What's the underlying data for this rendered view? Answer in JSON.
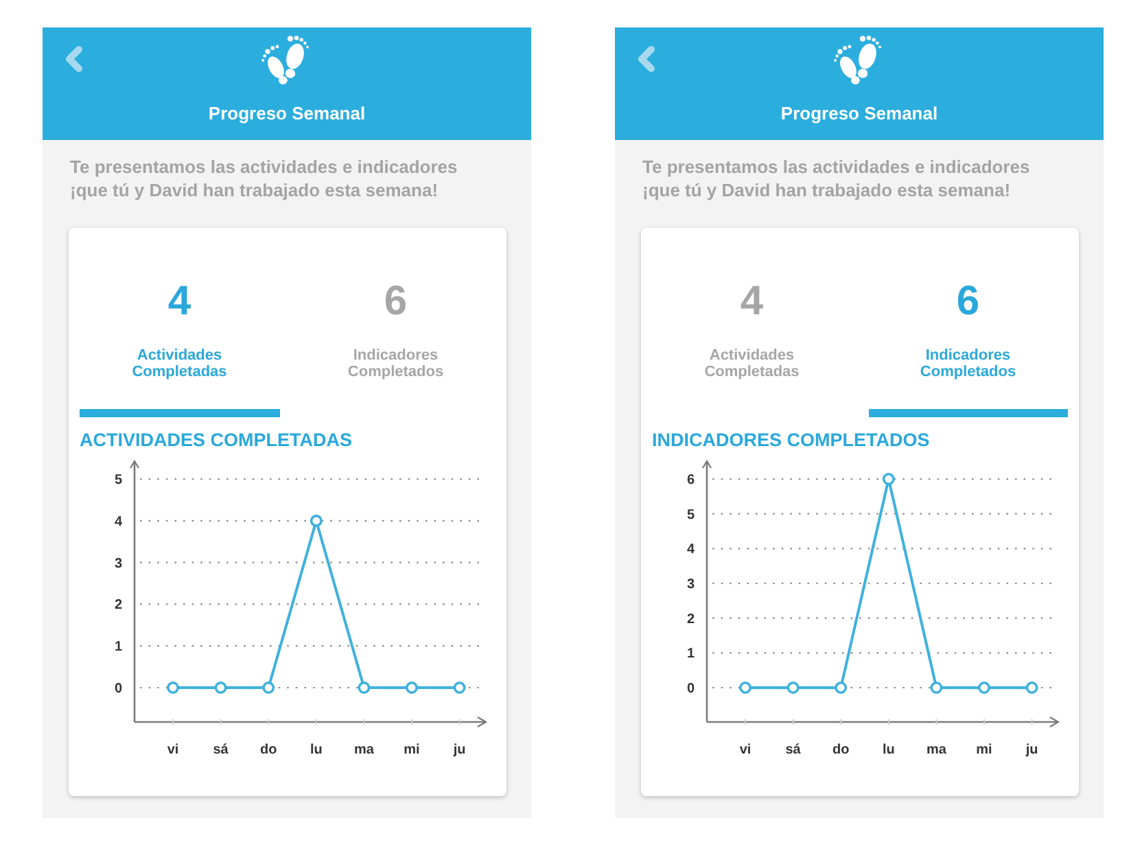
{
  "screens": [
    {
      "header": {
        "title": "Progreso Semanal"
      },
      "intro": "Te presentamos las actividades e indicadores ¡que tú y David han trabajado esta semana!",
      "tabs": [
        {
          "count": "4",
          "label": "Actividades Completadas",
          "selected": true
        },
        {
          "count": "6",
          "label": "Indicadores Completados",
          "selected": false
        }
      ],
      "chart_data": {
        "type": "line",
        "title": "ACTIVIDADES COMPLETADAS",
        "categories": [
          "vi",
          "sá",
          "do",
          "lu",
          "ma",
          "mi",
          "ju"
        ],
        "values": [
          0,
          0,
          0,
          4,
          0,
          0,
          0
        ],
        "ylim": [
          0,
          5
        ],
        "yticks": [
          0,
          1,
          2,
          3,
          4,
          5
        ],
        "grid": true,
        "marker": "circle"
      }
    },
    {
      "header": {
        "title": "Progreso Semanal"
      },
      "intro": "Te presentamos las actividades e indicadores ¡que tú y David han trabajado esta semana!",
      "tabs": [
        {
          "count": "4",
          "label": "Actividades Completadas",
          "selected": false
        },
        {
          "count": "6",
          "label": "Indicadores Completados",
          "selected": true
        }
      ],
      "chart_data": {
        "type": "line",
        "title": "INDICADORES COMPLETADOS",
        "categories": [
          "vi",
          "sá",
          "do",
          "lu",
          "ma",
          "mi",
          "ju"
        ],
        "values": [
          0,
          0,
          0,
          6,
          0,
          0,
          0
        ],
        "ylim": [
          0,
          6
        ],
        "yticks": [
          0,
          1,
          2,
          3,
          4,
          5,
          6
        ],
        "grid": true,
        "marker": "circle"
      }
    }
  ]
}
